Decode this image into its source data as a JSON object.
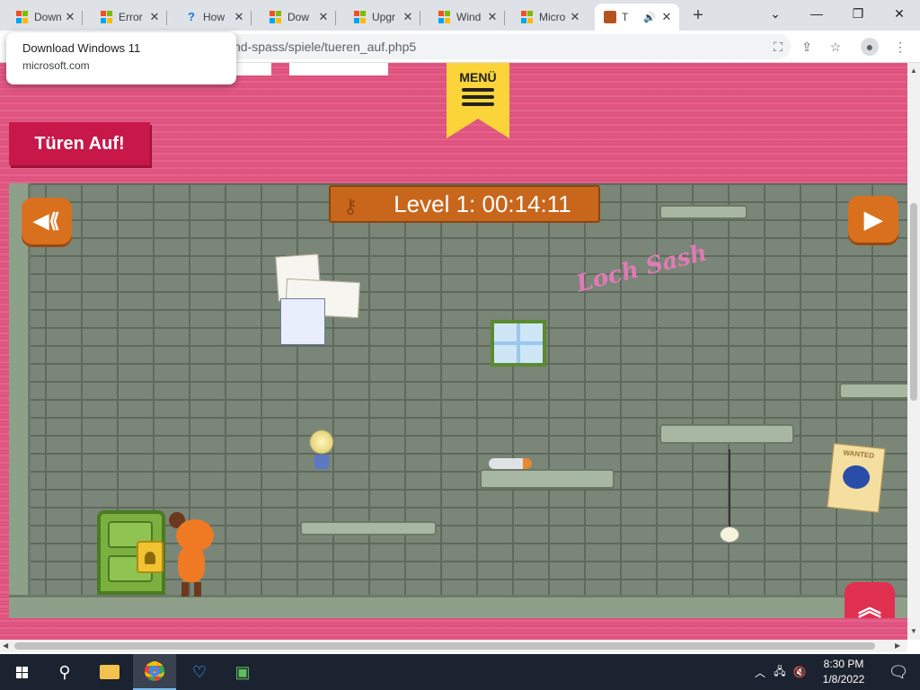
{
  "browser": {
    "tabs": [
      {
        "title": "Down",
        "favicon": "windows-logo-icon"
      },
      {
        "title": "Error",
        "favicon": "windows-logo-icon"
      },
      {
        "title": "How",
        "favicon": "help-circle-icon"
      },
      {
        "title": "Dow",
        "favicon": "windows-logo-icon"
      },
      {
        "title": "Upgr",
        "favicon": "windows-logo-icon"
      },
      {
        "title": "Wind",
        "favicon": "windows-logo-icon"
      },
      {
        "title": "Micro",
        "favicon": "windows-logo-icon"
      },
      {
        "title": "T",
        "favicon": "game-favicon-icon",
        "active": true,
        "audio": true
      }
    ],
    "new_tab_label": "+",
    "url_fragment": "nd-spass/spiele/tueren_auf.php5",
    "tooltip": {
      "title": "Download Windows 11",
      "domain": "microsoft.com"
    }
  },
  "page": {
    "menu_label": "MENÜ",
    "game_title": "Türen Auf!",
    "level_display": "Level 1: 00:14:11",
    "graffiti": "Loch Sash",
    "wanted_label": "WANTED"
  },
  "taskbar": {
    "time": "8:30 PM",
    "date": "1/8/2022"
  },
  "colors": {
    "page_background": "#e25d86",
    "menu_ribbon": "#fbd43a",
    "title_badge": "#c8184a",
    "level_banner": "#c8661c",
    "game_button_orange": "#d9701e",
    "game_button_red": "#e0304f",
    "brick_wall": "#7a8677"
  }
}
